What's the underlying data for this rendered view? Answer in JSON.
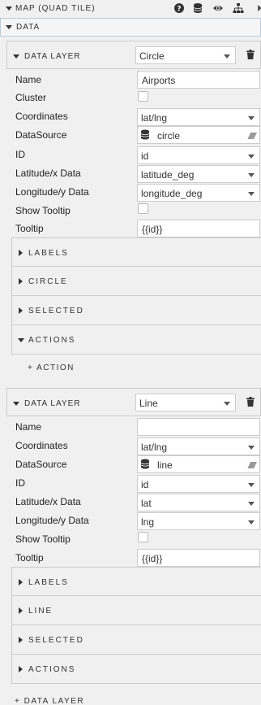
{
  "header": {
    "title": "MAP (QUAD TILE)",
    "icons": [
      "help-icon",
      "database-icon",
      "eye-icon",
      "hierarchy-icon",
      "expand-arrow-icon"
    ]
  },
  "data_section": {
    "title": "DATA"
  },
  "layers": [
    {
      "header_label": "DATA LAYER",
      "type_value": "Circle",
      "fields": {
        "name_label": "Name",
        "name_value": "Airports",
        "cluster_label": "Cluster",
        "coordinates_label": "Coordinates",
        "coordinates_value": "lat/lng",
        "datasource_label": "DataSource",
        "datasource_value": "circle",
        "id_label": "ID",
        "id_value": "id",
        "lat_label": "Latitude/x Data",
        "lat_value": "latitude_deg",
        "lng_label": "Longitude/y Data",
        "lng_value": "longitude_deg",
        "show_tooltip_label": "Show Tooltip",
        "tooltip_label": "Tooltip",
        "tooltip_value": "{{id}}"
      },
      "sections": [
        "LABELS",
        "CIRCLE",
        "SELECTED",
        "ACTIONS"
      ],
      "add_action": "+ ACTION"
    },
    {
      "header_label": "DATA LAYER",
      "type_value": "Line",
      "fields": {
        "name_label": "Name",
        "name_value": "",
        "coordinates_label": "Coordinates",
        "coordinates_value": "lat/lng",
        "datasource_label": "DataSource",
        "datasource_value": "line",
        "id_label": "ID",
        "id_value": "id",
        "lat_label": "Latitude/x Data",
        "lat_value": "lat",
        "lng_label": "Longitude/y Data",
        "lng_value": "lng",
        "show_tooltip_label": "Show Tooltip",
        "tooltip_label": "Tooltip",
        "tooltip_value": "{{id}}"
      },
      "sections": [
        "LABELS",
        "LINE",
        "SELECTED",
        "ACTIONS"
      ]
    }
  ],
  "add_data_layer": "+ DATA LAYER"
}
